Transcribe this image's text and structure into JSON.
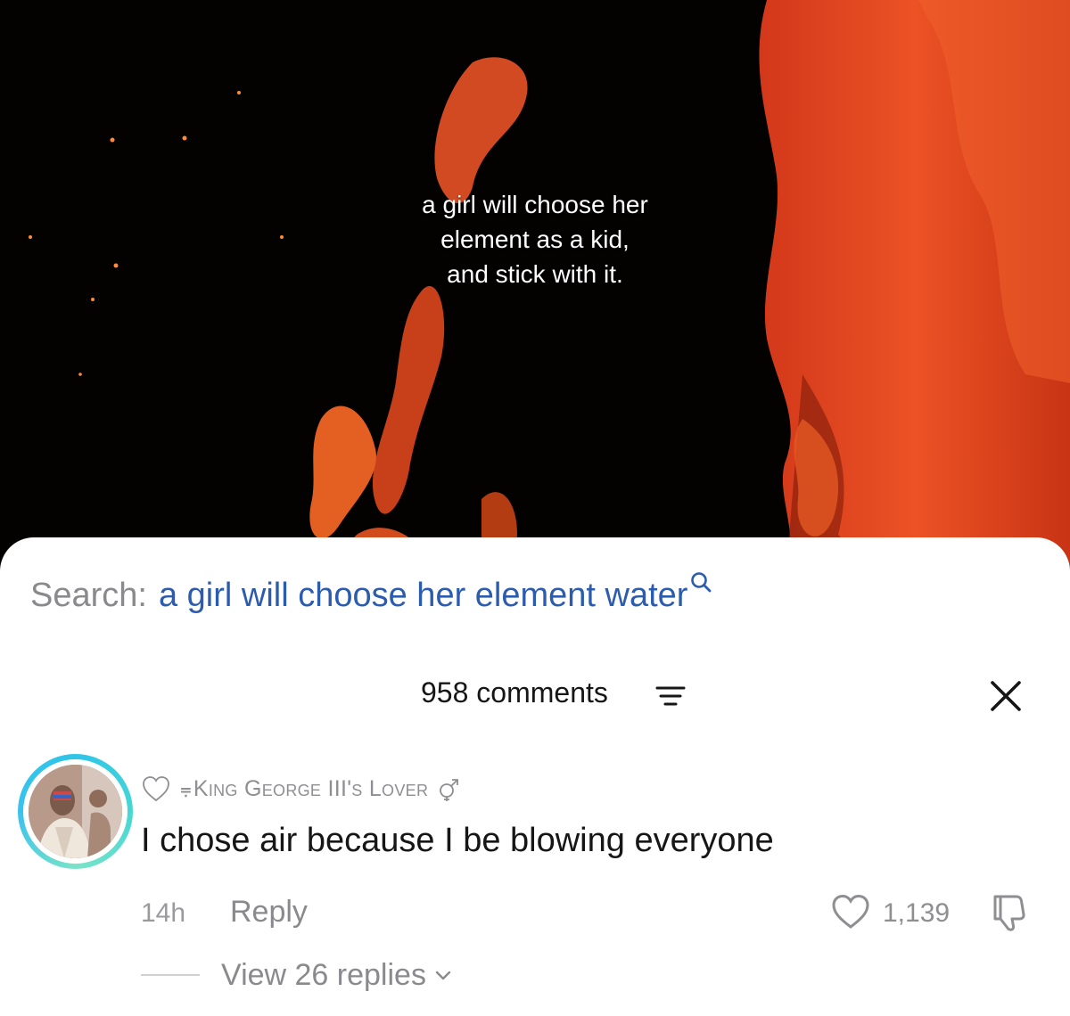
{
  "video": {
    "caption_lines": [
      "a girl will choose her",
      "element as a kid,",
      "and stick with it."
    ]
  },
  "search": {
    "prefix": "Search:",
    "query": "a girl will choose her element water",
    "icon": "search-icon"
  },
  "comments_header": {
    "count_label": "958 comments",
    "sort_icon": "filter-sort-icon",
    "close_icon": "close-icon"
  },
  "comment": {
    "avatar_icon": "avatar",
    "badge_icon": "heart-outline-icon",
    "user_prefix": "⩦",
    "username": "King George III's Lover",
    "gender_icon": "male-female-symbol-icon",
    "text": "I chose air because I be blowing everyone",
    "timestamp": "14h",
    "reply_label": "Reply",
    "like_count": "1,139",
    "view_replies_label": "View 26 replies"
  },
  "colors": {
    "search_query": "#2b5cae",
    "muted_text": "#8a8a8e",
    "avatar_ring": "#2ec5e8",
    "fire_orange": "#e8491c"
  }
}
